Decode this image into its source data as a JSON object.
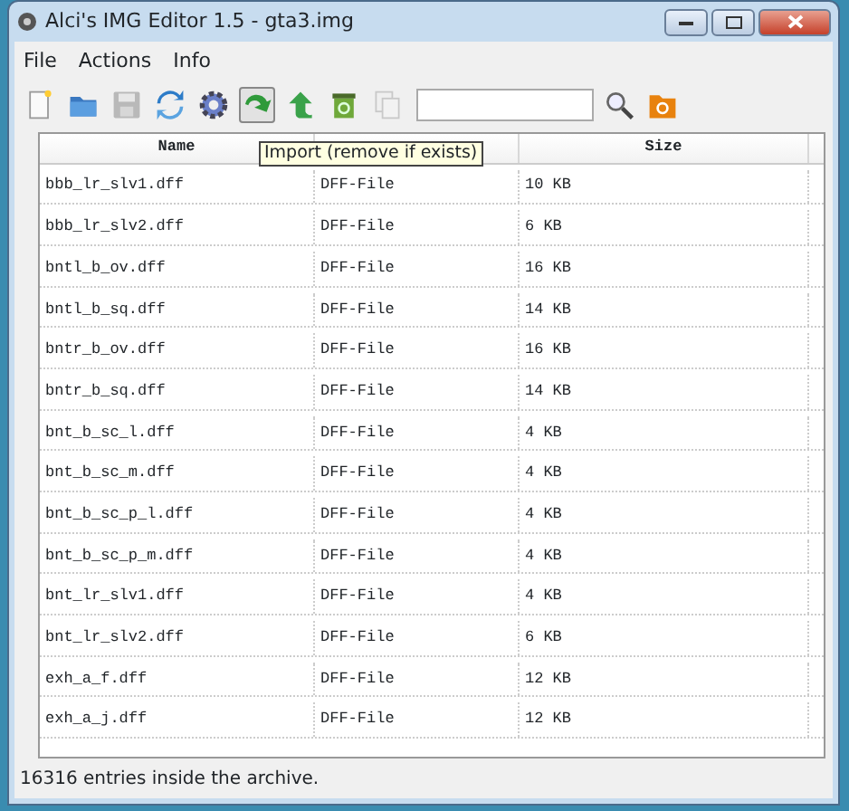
{
  "window": {
    "title": "Alci's IMG Editor 1.5 - gta3.img"
  },
  "menu": [
    "File",
    "Actions",
    "Info"
  ],
  "toolbar": [
    {
      "kind": "new",
      "disabled": false,
      "pressed": false
    },
    {
      "kind": "open",
      "disabled": false,
      "pressed": false
    },
    {
      "kind": "save",
      "disabled": true,
      "pressed": false
    },
    {
      "kind": "refresh",
      "disabled": false,
      "pressed": false
    },
    {
      "kind": "settings",
      "disabled": false,
      "pressed": false
    },
    {
      "kind": "import",
      "disabled": false,
      "pressed": true
    },
    {
      "kind": "export",
      "disabled": false,
      "pressed": false
    },
    {
      "kind": "delete",
      "disabled": false,
      "pressed": false
    },
    {
      "kind": "copy",
      "disabled": true,
      "pressed": false
    }
  ],
  "tooltip": "Import (remove if exists)",
  "table": {
    "columns": [
      "Name",
      null,
      "Size"
    ],
    "rows": [
      [
        "bbb_lr_slv1.dff",
        "DFF-File",
        "10 KB"
      ],
      [
        "bbb_lr_slv2.dff",
        "DFF-File",
        "6 KB"
      ],
      [
        "bntl_b_ov.dff",
        "DFF-File",
        "16 KB"
      ],
      [
        "bntl_b_sq.dff",
        "DFF-File",
        "14 KB"
      ],
      [
        "bntr_b_ov.dff",
        "DFF-File",
        "16 KB"
      ],
      [
        "bntr_b_sq.dff",
        "DFF-File",
        "14 KB"
      ],
      [
        "bnt_b_sc_l.dff",
        "DFF-File",
        "4 KB"
      ],
      [
        "bnt_b_sc_m.dff",
        "DFF-File",
        "4 KB"
      ],
      [
        "bnt_b_sc_p_l.dff",
        "DFF-File",
        "4 KB"
      ],
      [
        "bnt_b_sc_p_m.dff",
        "DFF-File",
        "4 KB"
      ],
      [
        "bnt_lr_slv1.dff",
        "DFF-File",
        "4 KB"
      ],
      [
        "bnt_lr_slv2.dff",
        "DFF-File",
        "6 KB"
      ],
      [
        "exh_a_f.dff",
        "DFF-File",
        "12 KB"
      ],
      [
        "exh_a_j.dff",
        "DFF-File",
        "12 KB"
      ]
    ]
  },
  "status_bar": "16316 entries inside the archive."
}
